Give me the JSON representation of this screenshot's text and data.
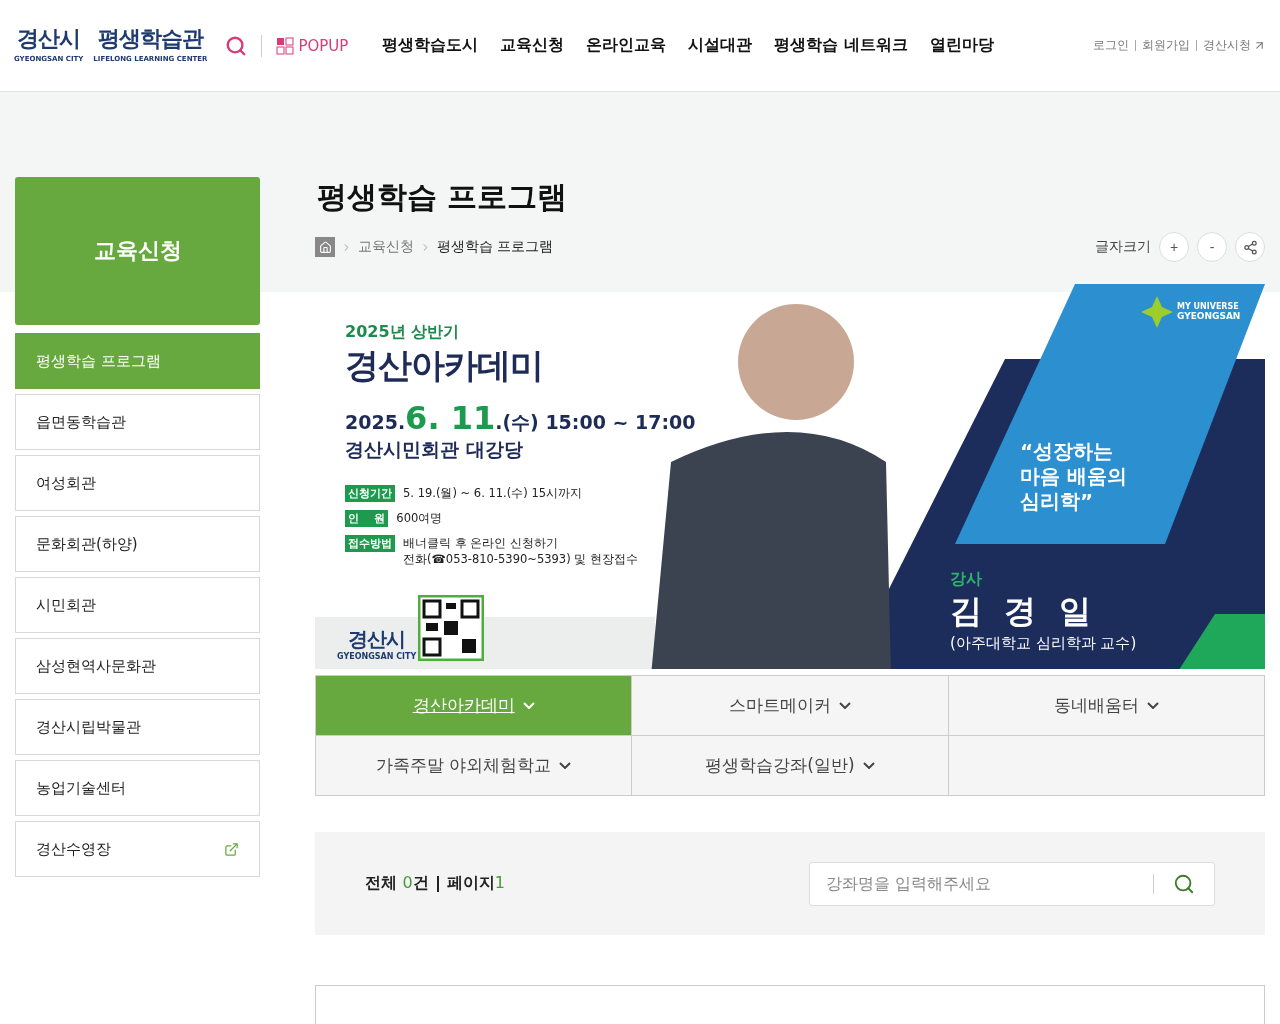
{
  "header": {
    "logo": {
      "city": "경산시",
      "city_en": "GYEONGSAN CITY",
      "center": "평생학습관",
      "center_en": "LIFELONG LEARNING CENTER"
    },
    "popup": "POPUP",
    "nav": [
      "평생학습도시",
      "교육신청",
      "온라인교육",
      "시설대관",
      "평생학습 네트워크",
      "열린마당"
    ],
    "util_links": [
      {
        "label": "로그인",
        "external": false
      },
      {
        "label": "회원가입",
        "external": false
      },
      {
        "label": "경산시청",
        "external": true
      }
    ]
  },
  "sidebar": {
    "title": "교육신청",
    "items": [
      {
        "label": "평생학습 프로그램",
        "selected": true,
        "external": false
      },
      {
        "label": "읍면동학습관",
        "selected": false,
        "external": false
      },
      {
        "label": "여성회관",
        "selected": false,
        "external": false
      },
      {
        "label": "문화회관(하양)",
        "selected": false,
        "external": false
      },
      {
        "label": "시민회관",
        "selected": false,
        "external": false
      },
      {
        "label": "삼성현역사문화관",
        "selected": false,
        "external": false
      },
      {
        "label": "경산시립박물관",
        "selected": false,
        "external": false
      },
      {
        "label": "농업기술센터",
        "selected": false,
        "external": false
      },
      {
        "label": "경산수영장",
        "selected": false,
        "external": true
      }
    ]
  },
  "page": {
    "title": "평생학습 프로그램",
    "breadcrumb": [
      "교육신청",
      "평생학습 프로그램"
    ],
    "font_size_label": "글자크기",
    "font_buttons": [
      "+",
      "-"
    ]
  },
  "banner": {
    "season": "2025년 상반기",
    "title": "경산아카데미",
    "date_prefix": "2025.",
    "date_highlight": "6. 11",
    "date_suffix": ".(수) 15:00 ~ 17:00",
    "venue": "경산시민회관 대강당",
    "info": [
      {
        "label": "신청기간",
        "lines": [
          "5. 19.(월) ~ 6. 11.(수) 15시까지"
        ]
      },
      {
        "label": "인    원",
        "lines": [
          "600여명"
        ]
      },
      {
        "label": "접수방법",
        "lines": [
          "배너클릭 후 온라인 신청하기",
          "전화(☎053-810-5390~5393) 및 현장접수"
        ]
      }
    ],
    "footer_logo": "경산시",
    "footer_logo_en": "GYEONGSAN CITY",
    "brand_top": "MY UNIVERSE",
    "brand": "GYEONGSAN",
    "quote": "“성장하는 마음 배움의 심리학”",
    "lecturer_label": "강사",
    "lecturer": "김  경  일",
    "lecturer_title": "(아주대학교 심리학과 교수)"
  },
  "categories": [
    {
      "label": "경산아카데미",
      "selected": true
    },
    {
      "label": "스마트메이커",
      "selected": false
    },
    {
      "label": "동네배움터",
      "selected": false
    },
    {
      "label": "가족주말 야외체험학교",
      "selected": false
    },
    {
      "label": "평생학습강좌(일반)",
      "selected": false
    }
  ],
  "search": {
    "total_label": "전체",
    "count": "0",
    "count_unit": "건",
    "page_label": "페이지",
    "page": "1",
    "placeholder": "강좌명을 입력해주세요"
  }
}
